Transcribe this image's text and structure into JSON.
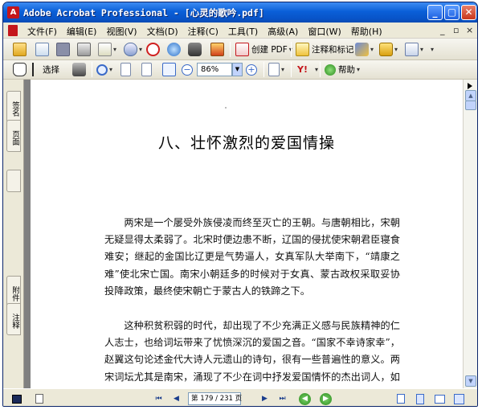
{
  "window": {
    "title": "Adobe Acrobat Professional - [心灵的歌吟.pdf]",
    "app_icon": "acrobat-icon",
    "controls": [
      "minimize-icon",
      "maximize-icon",
      "close-icon"
    ],
    "colors": {
      "titlebar": "#0a5fd8",
      "chrome": "#ece9d8",
      "doc_bg": "#808080",
      "acrobat_red": "#c4161c"
    }
  },
  "menubar": {
    "items": [
      "文件(F)",
      "编辑(E)",
      "视图(V)",
      "文档(D)",
      "注释(C)",
      "工具(T)",
      "高级(A)",
      "窗口(W)",
      "帮助(H)"
    ],
    "mdi_minimize": "_",
    "mdi_restore": "▫",
    "mdi_close": "×"
  },
  "toolbar1": {
    "create_pdf_label": "创建 PDF",
    "comment_label": "注释和标记"
  },
  "toolbar2": {
    "select_label": "选择",
    "zoom_value": "86%",
    "help_label": "帮助"
  },
  "sidenav": {
    "tabs": [
      "签名",
      "页面",
      "附件",
      "注释"
    ]
  },
  "document": {
    "chapter_title": "八、壮怀激烈的爱国情操",
    "paragraphs": [
      "两宋是一个屡受外族侵凌而终至灭亡的王朝。与唐朝相比，宋朝无疑显得太柔弱了。北宋时便边患不断，辽国的侵扰使宋朝君臣寝食难安；继起的金国比辽更是气势逼人，女真军队大举南下，“靖康之难”使北宋亡国。南宋小朝廷多的时候对于女真、蒙古政权采取妥协投降政策，最终使宋朝亡于蒙古人的铁蹄之下。",
      "这种积贫积弱的时代，却出现了不少充满正义感与民族精神的仁人志士，也给词坛带来了忧愤深沉的爱国之音。“国家不幸诗家幸”，赵翼这句论述金代大诗人元遗山的诗句，很有一些普遍性的意义。两宋词坛尤其是南宋，涌现了不少在词中抒发爱国情怀的杰出词人，如岳飞、辛弃疾、张孝祥、陈亮、刘过、刘克庄等"
    ]
  },
  "statusbar": {
    "page_indicator": "第 179 / 231 页"
  }
}
